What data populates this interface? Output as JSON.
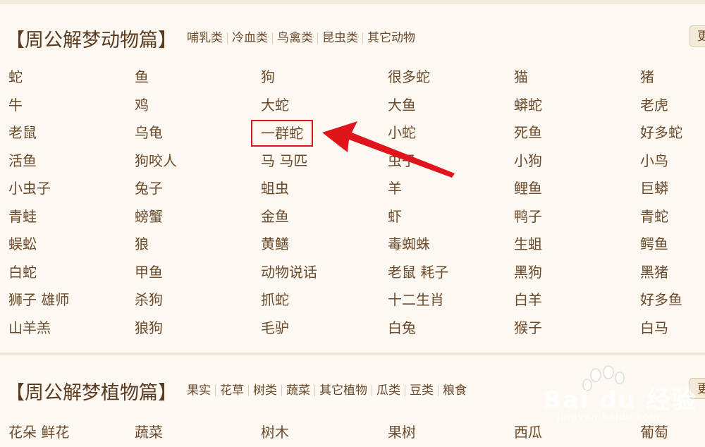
{
  "animals": {
    "title": "【周公解梦动物篇】",
    "links": [
      "哺乳类",
      "冷血类",
      "鸟禽类",
      "昆虫类",
      "其它动物"
    ],
    "more_label": "更",
    "items": [
      "蛇",
      "鱼",
      "狗",
      "很多蛇",
      "猫",
      "猪",
      "牛",
      "鸡",
      "大蛇",
      "大鱼",
      "蟒蛇",
      "老虎",
      "老鼠",
      "乌龟",
      "一群蛇",
      "小蛇",
      "死鱼",
      "好多蛇",
      "活鱼",
      "狗咬人",
      "马 马匹",
      "虫子",
      "小狗",
      "小鸟",
      "小虫子",
      "兔子",
      "蛆虫",
      "羊",
      "鲤鱼",
      "巨蟒",
      "青蛙",
      "螃蟹",
      "金鱼",
      "虾",
      "鸭子",
      "青蛇",
      "蜈蚣",
      "狼",
      "黄鳝",
      "毒蜘蛛",
      "生蛆",
      "鳄鱼",
      "白蛇",
      "甲鱼",
      "动物说话",
      "老鼠 耗子",
      "黑狗",
      "黑猪",
      "狮子 雄师",
      "杀狗",
      "抓蛇",
      "十二生肖",
      "白羊",
      "好多鱼",
      "山羊羔",
      "狼狗",
      "毛驴",
      "白兔",
      "猴子",
      "白马"
    ],
    "highlighted_item": "一群蛇"
  },
  "plants": {
    "title": "【周公解梦植物篇】",
    "links": [
      "果实",
      "花草",
      "树类",
      "蔬菜",
      "其它植物",
      "瓜类",
      "豆类",
      "粮食"
    ],
    "more_label": "更",
    "items": [
      "花朵 鲜花",
      "蔬菜",
      "树木",
      "果树",
      "西瓜",
      "葡萄"
    ]
  },
  "watermark": {
    "brand": "Bai du 经验",
    "url": "jingyan.baidu.com"
  },
  "colors": {
    "background": "#fdf9f2",
    "text": "#6b4a2b",
    "highlight": "#e0141b"
  }
}
